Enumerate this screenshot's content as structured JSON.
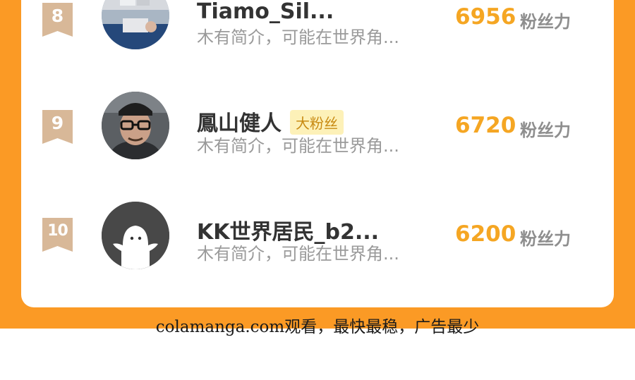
{
  "colors": {
    "background_accent": "#fb9a25",
    "card": "#ffffff",
    "score": "#f5a623",
    "badge_bg": "#fdf1b8",
    "badge_text": "#c88a12",
    "rank_badge": "#d8b898"
  },
  "ranking": {
    "unit_label": "粉丝力",
    "rows": [
      {
        "rank": "8",
        "name": "Tiamo_Sil...",
        "badge": "",
        "bio": "木有简介，可能在世界角...",
        "score": "6956",
        "avatar_icon": "photo-avatar-icon"
      },
      {
        "rank": "9",
        "name": "鳳山健人",
        "badge": "大粉丝",
        "bio": "木有简介，可能在世界角...",
        "score": "6720",
        "avatar_icon": "photo-avatar-icon"
      },
      {
        "rank": "10",
        "name": "KK世界居民_b2...",
        "badge": "",
        "bio": "木有简介，可能在世界角...",
        "score": "6200",
        "avatar_icon": "default-user-avatar-icon"
      }
    ]
  },
  "footer": {
    "watermark": "colamanga.com观看，最快最稳，广告最少"
  }
}
